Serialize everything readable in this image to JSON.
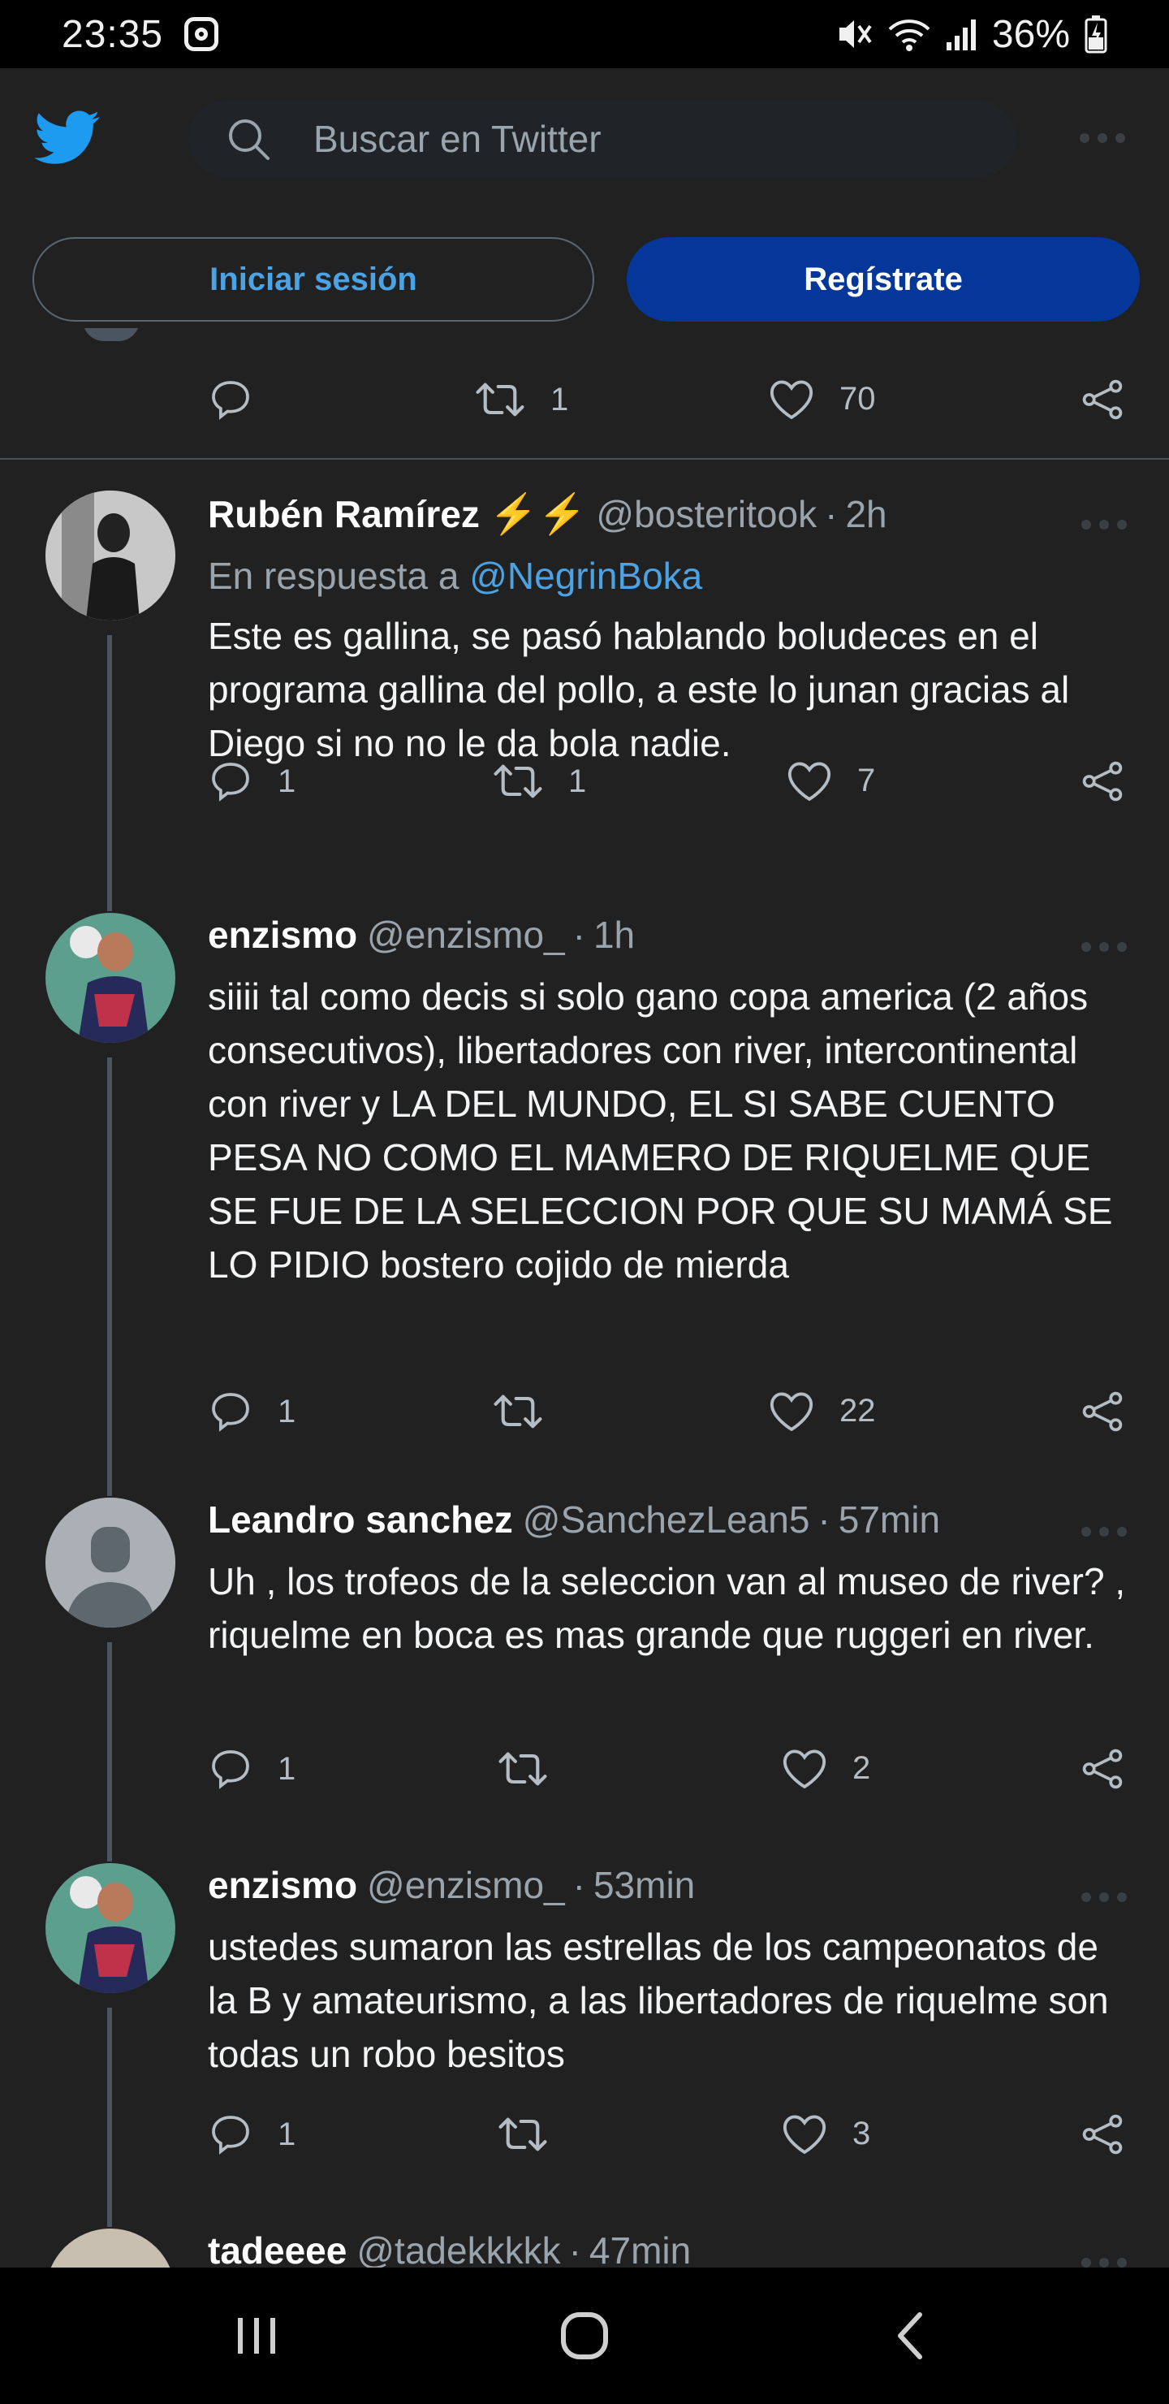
{
  "status_bar": {
    "time": "23:35",
    "battery": "36%",
    "icons": [
      "instagram-icon",
      "mute-icon",
      "wifi-icon",
      "signal-icon",
      "battery-icon"
    ]
  },
  "header": {
    "logo": "twitter-bird-icon",
    "search_placeholder": "Buscar en Twitter",
    "login_label": "Iniciar sesión",
    "signup_label": "Regístrate"
  },
  "colors": {
    "background": "#212121",
    "accent": "#4ba3e3",
    "signup": "#05379a",
    "muted": "#9aa4ad"
  },
  "prev_tweet": {
    "replies": "",
    "retweets": "1",
    "likes": "70"
  },
  "tweets": [
    {
      "name": "Rubén Ramírez",
      "emoji": "⚡⚡",
      "handle": "@bosteritook",
      "time": "2h",
      "reply_prefix": "En respuesta a",
      "reply_to": "@NegrinBoka",
      "text": "Este es gallina, se pasó hablando boludeces en el programa gallina del pollo, a este lo junan gracias al Diego si no no le da bola nadie.",
      "replies": "1",
      "retweets": "1",
      "likes": "7"
    },
    {
      "name": "enzismo",
      "handle": "@enzismo_",
      "time": "1h",
      "text": "siiii tal como decis si solo gano copa america (2 años consecutivos), libertadores con river, intercontinental con river y LA DEL MUNDO, EL SI SABE CUENTO PESA NO COMO EL MAMERO DE RIQUELME QUE SE FUE DE LA SELECCION POR QUE SU MAMÁ SE LO PIDIO bostero cojido de mierda",
      "replies": "1",
      "retweets": "",
      "likes": "22"
    },
    {
      "name": "Leandro sanchez",
      "handle": "@SanchezLean5",
      "time": "57min",
      "text": "Uh , los trofeos de la seleccion van  al  museo de river?  , riquelme en boca es mas grande que ruggeri en river.",
      "replies": "1",
      "retweets": "",
      "likes": "2"
    },
    {
      "name": "enzismo",
      "handle": "@enzismo_",
      "time": "53min",
      "text": "ustedes sumaron las estrellas de los campeonatos de la B y amateurismo, a las libertadores de riquelme son todas un robo besitos",
      "replies": "1",
      "retweets": "",
      "likes": "3"
    },
    {
      "name": "tadeeee",
      "handle": "@tadekkkkk",
      "time": "47min"
    }
  ]
}
